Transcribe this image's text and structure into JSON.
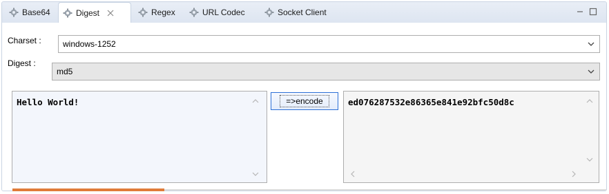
{
  "tabs": [
    {
      "label": "Base64",
      "icon": "gear-icon"
    },
    {
      "label": "Digest",
      "icon": "gear-icon",
      "active": true
    },
    {
      "label": "Regex",
      "icon": "gear-icon"
    },
    {
      "label": "URL Codec",
      "icon": "gear-icon"
    },
    {
      "label": "Socket Client",
      "icon": "gear-icon"
    }
  ],
  "form": {
    "charset_label": "Charset :",
    "charset_value": "windows-1252",
    "digest_label": "Digest :",
    "digest_value": "md5"
  },
  "input_text": "Hello World!",
  "encode_button": "=>encode",
  "output_text": "ed076287532e86365e841e92bfc50d8c",
  "colors": {
    "accent": "#2b6fd6",
    "tab_bar": "#dde5f1",
    "text_area_bg": "#f3f6fc",
    "status_strip": "#e07b39"
  }
}
